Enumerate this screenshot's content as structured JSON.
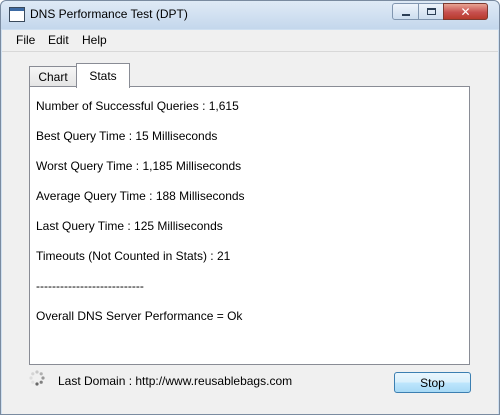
{
  "window": {
    "title": "DNS Performance Test (DPT)",
    "close_glyph": "✕"
  },
  "menu": {
    "file": "File",
    "edit": "Edit",
    "help": "Help"
  },
  "tabs": [
    {
      "label": "Chart",
      "active": false
    },
    {
      "label": "Stats",
      "active": true
    }
  ],
  "stats": {
    "successful_queries": "Number of Successful Queries : 1,615",
    "best_query": "Best Query Time : 15 Milliseconds",
    "worst_query": "Worst Query Time : 1,185 Milliseconds",
    "average_query": "Average Query Time : 188 Milliseconds",
    "last_query": "Last Query Time : 125 Milliseconds",
    "timeouts": "Timeouts (Not Counted in Stats) : 21",
    "separator": "---------------------------",
    "overall": "Overall DNS Server Performance = Ok"
  },
  "footer": {
    "last_domain": "Last Domain : http://www.reusablebags.com",
    "stop_label": "Stop",
    "spinner_icon": "busy-spinner-icon"
  },
  "colors": {
    "title_bar": "#c4d7ec",
    "close_button": "#c75050",
    "stop_button": "#bee6fd"
  }
}
